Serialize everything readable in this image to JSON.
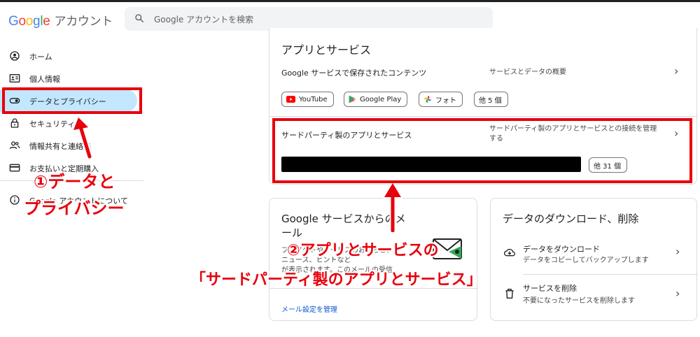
{
  "header": {
    "logo_google": [
      "G",
      "o",
      "o",
      "g",
      "l",
      "e"
    ],
    "logo_suffix": "アカウント",
    "search_placeholder": "Google アカウントを検索",
    "top_right_faint": ""
  },
  "sidebar": {
    "items": [
      {
        "label": "ホーム",
        "icon": "home-icon"
      },
      {
        "label": "個人情報",
        "icon": "id-card-icon"
      },
      {
        "label": "データとプライバシー",
        "icon": "toggle-icon"
      },
      {
        "label": "セキュリティ",
        "icon": "lock-icon"
      },
      {
        "label": "情報共有と連絡先",
        "icon": "people-icon"
      },
      {
        "label": "お支払いと定期購入",
        "icon": "credit-card-icon"
      },
      {
        "label": "Google アカウントについて",
        "icon": "info-icon"
      }
    ]
  },
  "apps_card": {
    "title": "アプリとサービス",
    "row1_label": "Google サービスで保存されたコンテンツ",
    "row1_desc": "サービスとデータの概要",
    "chips": [
      {
        "label": "YouTube",
        "icon": "youtube-icon"
      },
      {
        "label": "Google Play",
        "icon": "google-play-icon"
      },
      {
        "label": "フォト",
        "icon": "photos-icon"
      },
      {
        "label": "他 5 個",
        "icon": ""
      }
    ],
    "row2_label": "サードパーティ製のアプリとサービス",
    "row2_desc_line1": "サードパーティ製のアプリとサービスとの接続を管理",
    "row2_desc_line2": "する",
    "row2_more_chip": "他 31 個"
  },
  "email_card": {
    "title_line1": "Google サービスからのメ",
    "title_line2": "ール",
    "body_line1": "プロダクトやサービスのお知らせ、",
    "body_line2": "ニュース、ヒントなど",
    "body_line3": "が表示されます。このメールの受信",
    "link": "メール設定を管理"
  },
  "download_card": {
    "title": "データのダウンロード、削除",
    "row1_label": "データをダウンロード",
    "row1_desc": "データをコピーしてバックアップします",
    "row2_label": "サービスを削除",
    "row2_desc": "不要になったサービスを削除します"
  },
  "annotations": {
    "a1_line1": "①データと",
    "a1_line2": "プライバシー",
    "a2_line1": "②アプリとサービスの",
    "a2_line2": "「サードパーティ製のアプリとサービス」",
    "color": "#e8000b"
  },
  "colors": {
    "active_nav": "#c2e7ff",
    "link": "#0b57d0",
    "annotation_red": "#e8000b"
  }
}
